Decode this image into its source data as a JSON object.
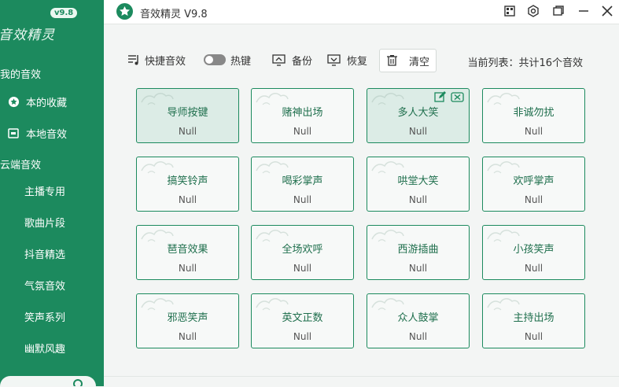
{
  "colors": {
    "brand": "#1c8a5e",
    "card_text": "#1f6f4d",
    "active_card": "#dcece6"
  },
  "sidebar": {
    "logo_text": "音效精灵",
    "version_badge": "v9.8",
    "my_sounds_title": "我的音效",
    "favorites_label": "本的收藏",
    "local_label": "本地音效",
    "cloud_title": "云端音效",
    "cloud_items": [
      "主播专用",
      "歌曲片段",
      "抖音精选",
      "气氛音效",
      "笑声系列",
      "幽默风趣"
    ]
  },
  "titlebar": {
    "title": "音效精灵 V9.8"
  },
  "toolbar": {
    "quick_sound": "快捷音效",
    "hotkey": "热键",
    "backup": "备份",
    "restore": "恢复",
    "clear": "清空",
    "list_info": "当前列表：共计16个音效"
  },
  "cards": [
    {
      "name": "导师按键",
      "value": "Null",
      "active": true
    },
    {
      "name": "赌神出场",
      "value": "Null"
    },
    {
      "name": "多人大笑",
      "value": "Null",
      "active": true,
      "editing": true
    },
    {
      "name": "非诚勿扰",
      "value": "Null"
    },
    {
      "name": "搞笑铃声",
      "value": "Null"
    },
    {
      "name": "喝彩掌声",
      "value": "Null"
    },
    {
      "name": "哄堂大笑",
      "value": "Null"
    },
    {
      "name": "欢呼掌声",
      "value": "Null"
    },
    {
      "name": "琶音效果",
      "value": "Null"
    },
    {
      "name": "全场欢呼",
      "value": "Null"
    },
    {
      "name": "西游插曲",
      "value": "Null"
    },
    {
      "name": "小孩笑声",
      "value": "Null"
    },
    {
      "name": "邪恶笑声",
      "value": "Null"
    },
    {
      "name": "英文正数",
      "value": "Null"
    },
    {
      "name": "众人鼓掌",
      "value": "Null"
    },
    {
      "name": "主持出场",
      "value": "Null"
    }
  ]
}
